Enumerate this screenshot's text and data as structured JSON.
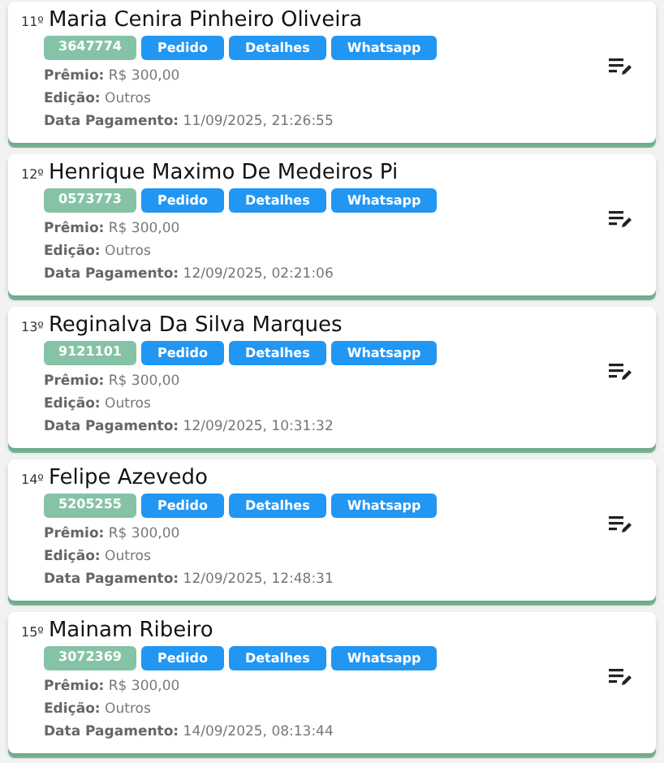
{
  "entries": [
    {
      "rank": "11º",
      "name": "Maria Cenira Pinheiro Oliveira",
      "code": "3647774",
      "buttons": [
        "Pedido",
        "Detalhes",
        "Whatsapp"
      ],
      "fields": [
        {
          "label": "Prêmio:",
          "value": "R$ 300,00"
        },
        {
          "label": "Edição:",
          "value": "Outros"
        },
        {
          "label": "Data Pagamento:",
          "value": "11/09/2025, 21:26:55"
        }
      ]
    },
    {
      "rank": "12º",
      "name": "Henrique Maximo De Medeiros Pi",
      "code": "0573773",
      "buttons": [
        "Pedido",
        "Detalhes",
        "Whatsapp"
      ],
      "fields": [
        {
          "label": "Prêmio:",
          "value": "R$ 300,00"
        },
        {
          "label": "Edição:",
          "value": "Outros"
        },
        {
          "label": "Data Pagamento:",
          "value": "12/09/2025, 02:21:06"
        }
      ]
    },
    {
      "rank": "13º",
      "name": "Reginalva Da Silva Marques",
      "code": "9121101",
      "buttons": [
        "Pedido",
        "Detalhes",
        "Whatsapp"
      ],
      "fields": [
        {
          "label": "Prêmio:",
          "value": "R$ 300,00"
        },
        {
          "label": "Edição:",
          "value": "Outros"
        },
        {
          "label": "Data Pagamento:",
          "value": "12/09/2025, 10:31:32"
        }
      ]
    },
    {
      "rank": "14º",
      "name": "Felipe Azevedo",
      "code": "5205255",
      "buttons": [
        "Pedido",
        "Detalhes",
        "Whatsapp"
      ],
      "fields": [
        {
          "label": "Prêmio:",
          "value": "R$ 300,00"
        },
        {
          "label": "Edição:",
          "value": "Outros"
        },
        {
          "label": "Data Pagamento:",
          "value": "12/09/2025, 12:48:31"
        }
      ]
    },
    {
      "rank": "15º",
      "name": "Mainam Ribeiro",
      "code": "3072369",
      "buttons": [
        "Pedido",
        "Detalhes",
        "Whatsapp"
      ],
      "fields": [
        {
          "label": "Prêmio:",
          "value": "R$ 300,00"
        },
        {
          "label": "Edição:",
          "value": "Outros"
        },
        {
          "label": "Data Pagamento:",
          "value": "14/09/2025, 08:13:44"
        }
      ]
    }
  ]
}
